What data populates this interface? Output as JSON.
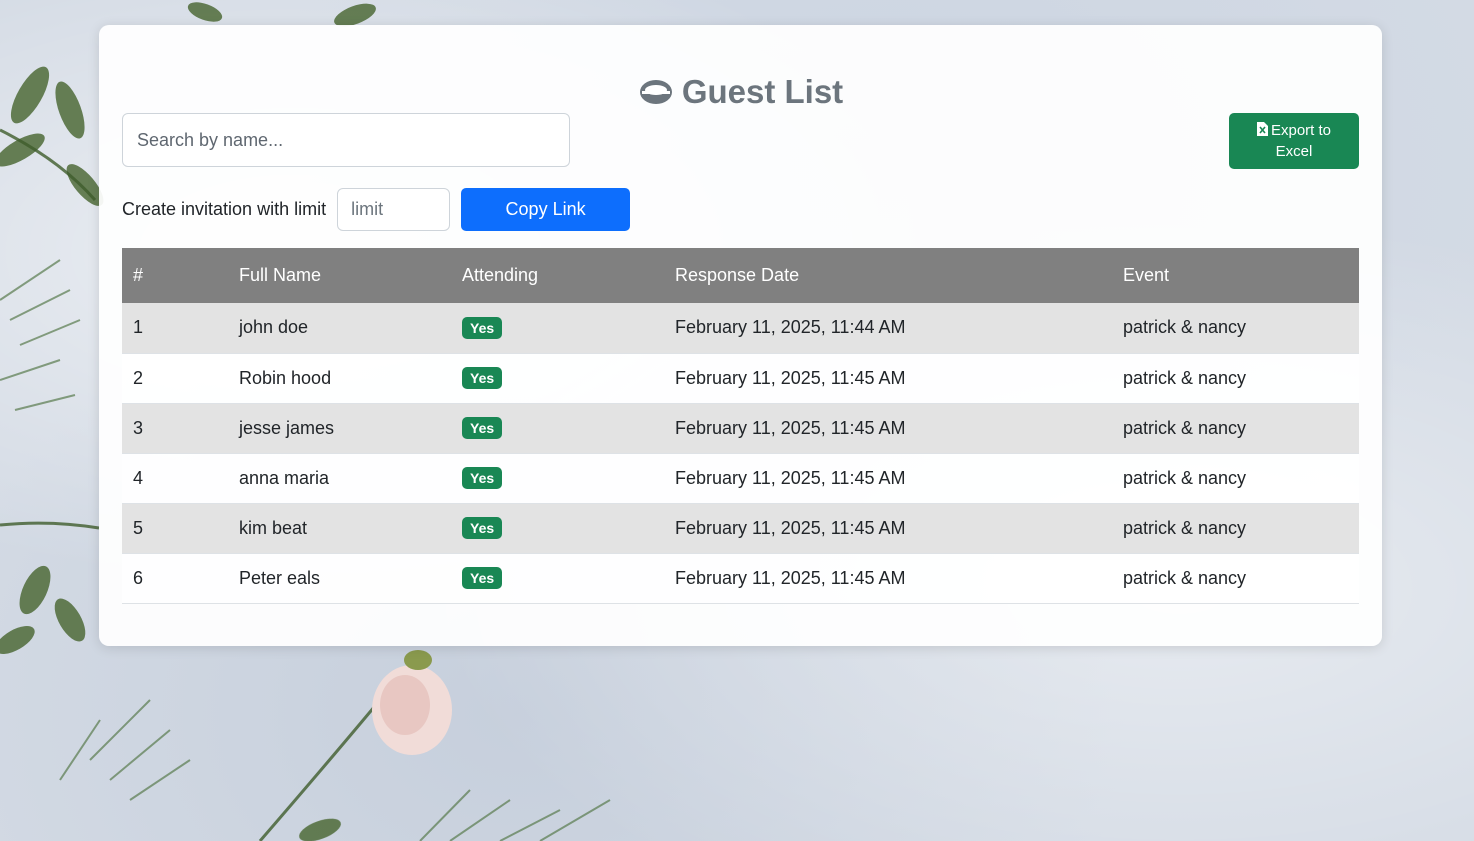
{
  "header": {
    "title": "Guest List",
    "icon": "ring-icon"
  },
  "search": {
    "placeholder": "Search by name...",
    "value": ""
  },
  "export": {
    "label": "Export to Excel",
    "icon": "excel-file-icon"
  },
  "invitation": {
    "label": "Create invitation with limit",
    "limit_placeholder": "limit",
    "copy_label": "Copy Link"
  },
  "table": {
    "columns": [
      "#",
      "Full Name",
      "Attending",
      "Response Date",
      "Event"
    ],
    "rows": [
      {
        "num": "1",
        "name": "john doe",
        "attending": "Yes",
        "date": "February 11, 2025, 11:44 AM",
        "event": "patrick & nancy"
      },
      {
        "num": "2",
        "name": "Robin hood",
        "attending": "Yes",
        "date": "February 11, 2025, 11:45 AM",
        "event": "patrick & nancy"
      },
      {
        "num": "3",
        "name": "jesse james",
        "attending": "Yes",
        "date": "February 11, 2025, 11:45 AM",
        "event": "patrick & nancy"
      },
      {
        "num": "4",
        "name": "anna maria",
        "attending": "Yes",
        "date": "February 11, 2025, 11:45 AM",
        "event": "patrick & nancy"
      },
      {
        "num": "5",
        "name": "kim beat",
        "attending": "Yes",
        "date": "February 11, 2025, 11:45 AM",
        "event": "patrick & nancy"
      },
      {
        "num": "6",
        "name": "Peter eals",
        "attending": "Yes",
        "date": "February 11, 2025, 11:45 AM",
        "event": "patrick & nancy"
      }
    ]
  },
  "colors": {
    "title": "#6c757d",
    "export_button": "#198754",
    "copy_button": "#0d6efd",
    "table_header": "#808080",
    "badge": "#198754"
  }
}
